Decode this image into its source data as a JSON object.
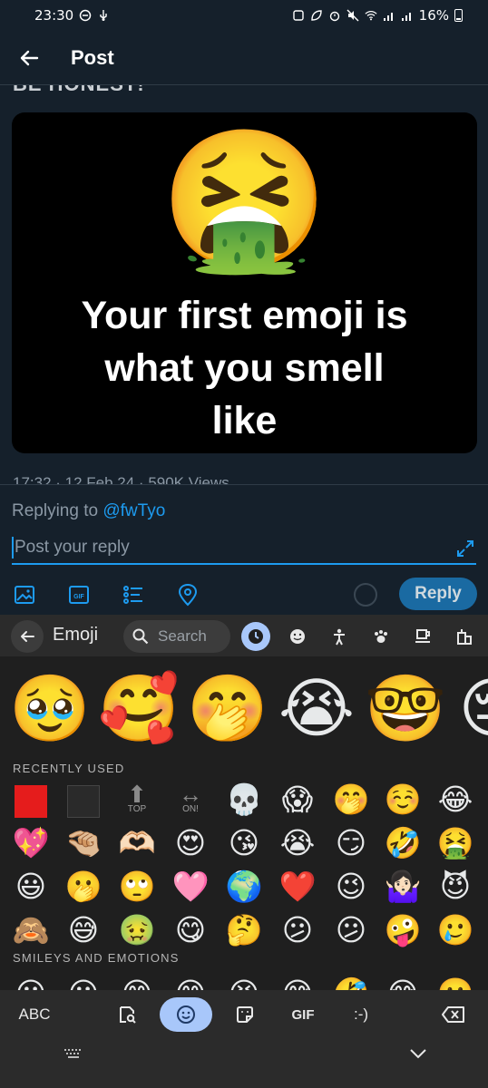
{
  "status_bar": {
    "time": "23:30",
    "battery": "16%"
  },
  "app_bar": {
    "title": "Post"
  },
  "post": {
    "partial_header_text": "BE HONEST!",
    "image_emoji": "🤮",
    "caption_line1": "Your first emoji is",
    "caption_line2": "what you smell",
    "caption_line3": "like",
    "meta_partial": "17:32 · 12 Feb 24 · 590K Views"
  },
  "reply": {
    "replying_to_prefix": "Replying to ",
    "replying_to_handle": "@fwTyo",
    "input_placeholder": "Post your reply",
    "reply_button": "Reply",
    "tools": [
      "image-icon",
      "gif-icon",
      "poll-icon",
      "location-icon"
    ],
    "accent": "#1d9bf0"
  },
  "keyboard": {
    "title": "Emoji",
    "search_placeholder": "Search",
    "categories": [
      "recent-icon",
      "smiley-icon",
      "person-icon",
      "animal-icon",
      "food-icon",
      "travel-icon"
    ],
    "suggested": [
      "🥹",
      "🥰",
      "🤭",
      "😭",
      "🤓",
      "😔"
    ],
    "recently_used_label": "RECENTLY USED",
    "recently_used": [
      [
        "🟥",
        "⬛",
        "TOP",
        "ON!",
        "💀",
        "😱",
        "🤭",
        "☺️",
        "😂"
      ],
      [
        "💖",
        "🤏🏼",
        "🫶🏻",
        "😍",
        "😘",
        "😭",
        "😏",
        "🤣",
        "🤮"
      ],
      [
        "😃",
        "🫢",
        "🙄",
        "🩷",
        "🌍",
        "❤️",
        "😉",
        "🤷🏻‍♀️",
        "😈"
      ],
      [
        "🙈",
        "😅",
        "🤢",
        "😋",
        "🤔",
        "😕",
        "😕",
        "🤪",
        "🥲"
      ]
    ],
    "smileys_label": "SMILEYS AND EMOTIONS",
    "smileys_partial": [
      "😀",
      "😃",
      "😄",
      "😁",
      "😆",
      "😅",
      "🤣",
      "😂",
      "🥲"
    ],
    "bottom": {
      "abc": "ABC",
      "gif": "GIF",
      "emoticon": ":-)"
    }
  }
}
